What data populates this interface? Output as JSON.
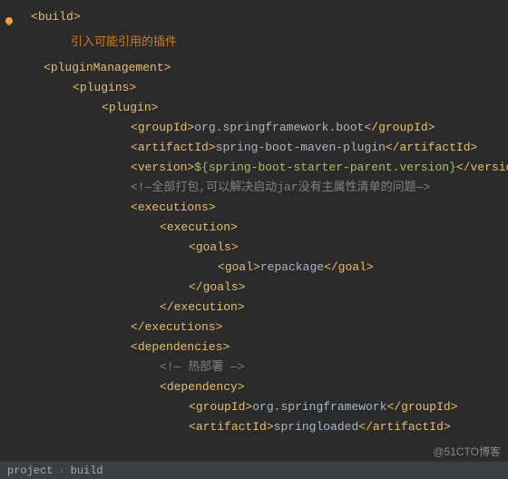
{
  "annotation": "引入可能引用的插件",
  "xml": {
    "build": "build",
    "pluginManagement": "pluginManagement",
    "plugins": "plugins",
    "plugin": "plugin",
    "groupId": "groupId",
    "artifactId": "artifactId",
    "version": "version",
    "executions": "executions",
    "execution": "execution",
    "goals": "goals",
    "goal": "goal",
    "dependencies": "dependencies",
    "dependency": "dependency"
  },
  "values": {
    "groupId1": "org.springframework.boot",
    "artifactId1": "spring-boot-maven-plugin",
    "version1": "${spring-boot-starter-parent.version}",
    "comment1": "<!—全部打包,可以解决启动jar没有主属性清单的问题—>",
    "goal1": "repackage",
    "comment2": "<!— 热部署 —>",
    "groupId2": "org.springframework",
    "artifactId2": "springloaded"
  },
  "breadcrumb": {
    "item1": "project",
    "item2": "build"
  },
  "watermark": "@51CTO博客"
}
